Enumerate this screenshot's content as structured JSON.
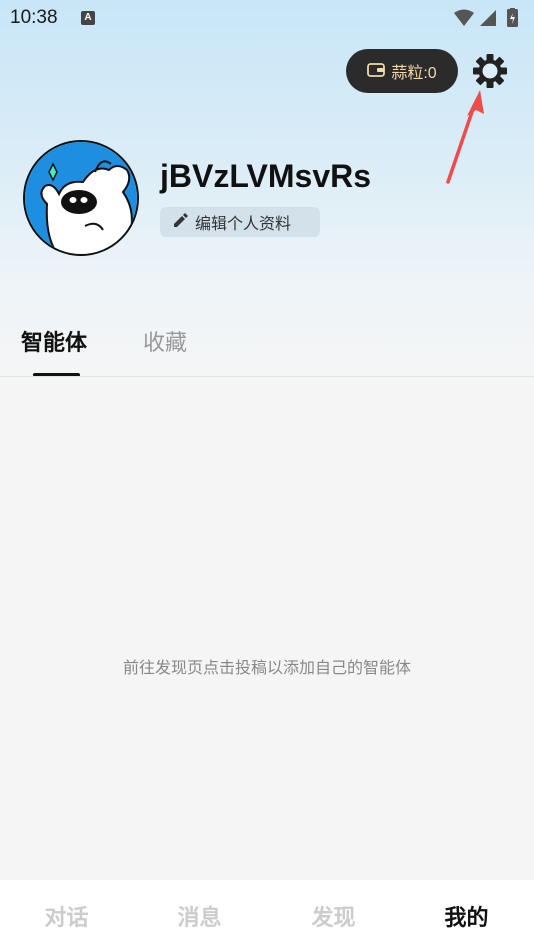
{
  "status_bar": {
    "time": "10:38",
    "notification_icon": "A"
  },
  "header": {
    "wallet_label": "蒜粒:0"
  },
  "profile": {
    "username": "jBVzLVMsvRs",
    "edit_label": "编辑个人资料"
  },
  "tabs": [
    {
      "label": "智能体",
      "active": true
    },
    {
      "label": "收藏",
      "active": false
    }
  ],
  "empty_state": {
    "message": "前往发现页点击投稿以添加自己的智能体"
  },
  "bottom_nav": [
    {
      "label": "对话",
      "active": false
    },
    {
      "label": "消息",
      "active": false
    },
    {
      "label": "发现",
      "active": false
    },
    {
      "label": "我的",
      "active": true
    }
  ],
  "colors": {
    "accent_dark": "#2b2b2b",
    "wallet_text": "#f3d9a8",
    "annotation_arrow": "#ef4b4b",
    "avatar_bg": "#1e8fe0"
  }
}
